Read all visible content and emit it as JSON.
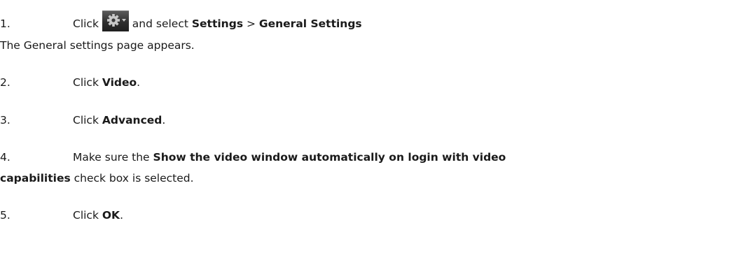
{
  "steps": [
    {
      "number": "1.",
      "click_word": "Click",
      "after_icon": " and select ",
      "menu_settings": "Settings",
      "separator": " > ",
      "menu_general": "General Settings"
    },
    {
      "result_text": "The General settings page appears."
    },
    {
      "number": "2.",
      "click_word": "Click ",
      "target": "Video",
      "end": "."
    },
    {
      "number": "3.",
      "click_word": "Click ",
      "target": "Advanced",
      "end": "."
    },
    {
      "number": "4.",
      "prefix": "Make sure the ",
      "target_part1": "Show the video window automatically on login with video",
      "target_part2": "capabilities",
      "suffix": " check box is selected."
    },
    {
      "number": "5.",
      "click_word": "Click ",
      "target": "OK",
      "end": "."
    }
  ],
  "icons": {
    "settings_button": "gear-dropdown-icon"
  },
  "colors": {
    "text": "#1a1a1a",
    "icon_background": "#2e2e2e",
    "icon_gear": "#c8c8c8"
  }
}
